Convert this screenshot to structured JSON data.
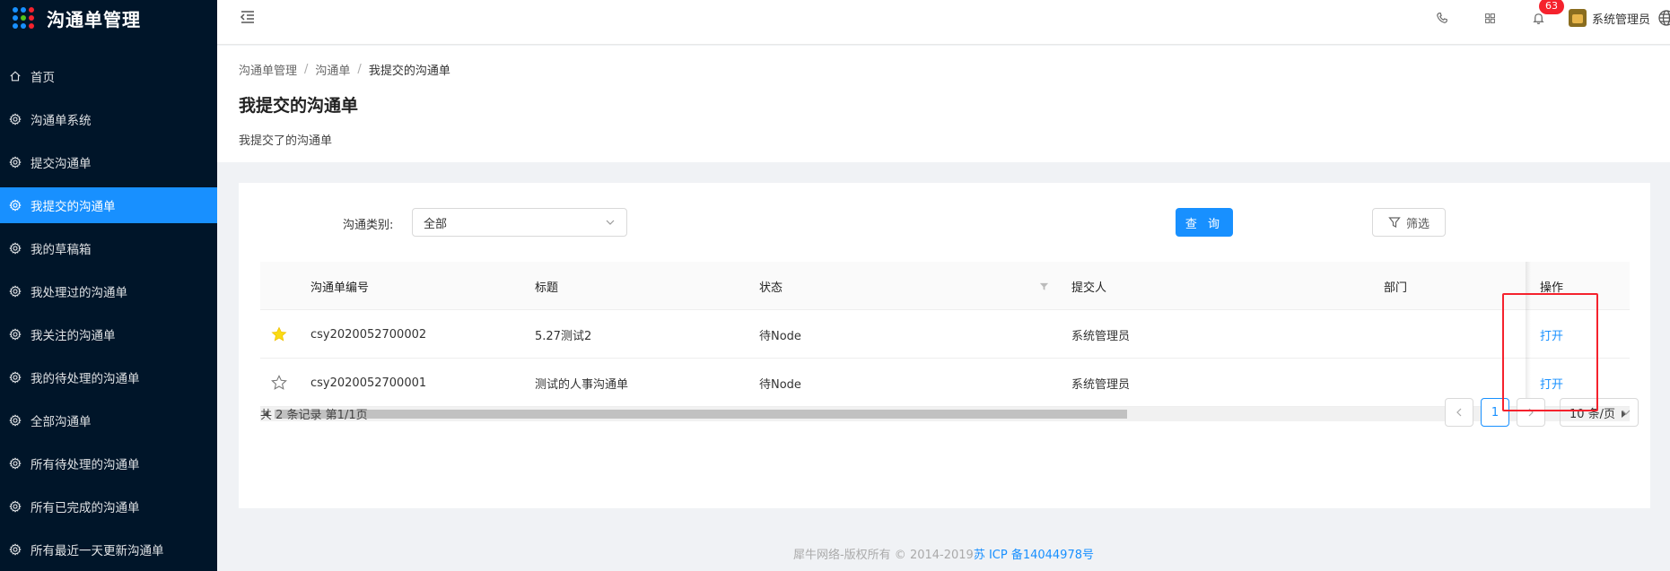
{
  "app": {
    "title": "沟通单管理"
  },
  "sidebar": {
    "items": [
      {
        "label": "首页",
        "icon": "home-icon",
        "active": false
      },
      {
        "label": "沟通单系统",
        "icon": "gear-icon",
        "active": false
      },
      {
        "label": "提交沟通单",
        "icon": "gear-icon",
        "active": false
      },
      {
        "label": "我提交的沟通单",
        "icon": "gear-icon",
        "active": true
      },
      {
        "label": "我的草稿箱",
        "icon": "gear-icon",
        "active": false
      },
      {
        "label": "我处理过的沟通单",
        "icon": "gear-icon",
        "active": false
      },
      {
        "label": "我关注的沟通单",
        "icon": "gear-icon",
        "active": false
      },
      {
        "label": "我的待处理的沟通单",
        "icon": "gear-icon",
        "active": false
      },
      {
        "label": "全部沟通单",
        "icon": "gear-icon",
        "active": false
      },
      {
        "label": "所有待处理的沟通单",
        "icon": "gear-icon",
        "active": false
      },
      {
        "label": "所有已完成的沟通单",
        "icon": "gear-icon",
        "active": false
      },
      {
        "label": "所有最近一天更新沟通单",
        "icon": "gear-icon",
        "active": false
      }
    ]
  },
  "header": {
    "notification_count": "63",
    "username": "系统管理员"
  },
  "breadcrumb": [
    "沟通单管理",
    "沟通单",
    "我提交的沟通单"
  ],
  "page": {
    "title": "我提交的沟通单",
    "description": "我提交了的沟通单"
  },
  "filter": {
    "category_label": "沟通类别:",
    "category_value": "全部",
    "query_button": "查 询",
    "filter_button": "筛选"
  },
  "table": {
    "columns": {
      "code": "沟通单编号",
      "title": "标题",
      "status": "状态",
      "submitter": "提交人",
      "dept": "部门",
      "operation": "操作"
    },
    "rows": [
      {
        "starred": true,
        "code": "csy2020052700002",
        "title": "5.27测试2",
        "status": "待Node",
        "submitter": "系统管理员",
        "dept": "",
        "action": "打开"
      },
      {
        "starred": false,
        "code": "csy2020052700001",
        "title": "测试的人事沟通单",
        "status": "待Node",
        "submitter": "系统管理员",
        "dept": "",
        "action": "打开"
      }
    ]
  },
  "pagination": {
    "summary": "共 2 条记录 第1/1页",
    "current_page": "1",
    "page_size": "10 条/页"
  },
  "footer": {
    "copyright": "犀牛网络-版权所有 © 2014-2019",
    "icp": "苏 ICP 备14044978号"
  },
  "colors": {
    "primary": "#1890ff",
    "sidebar_bg": "#001529",
    "star": "#fadb14",
    "highlight_box": "#f5222d",
    "badge": "#f5222d"
  }
}
